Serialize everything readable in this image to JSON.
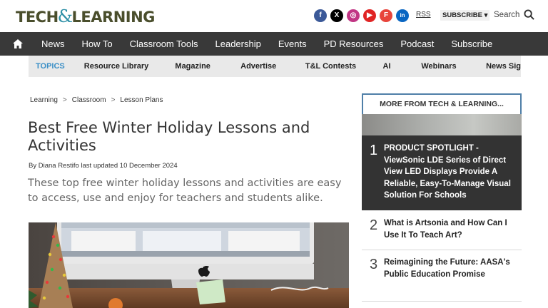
{
  "brand": {
    "logo_left": "TECH",
    "logo_amp": "&",
    "logo_right": "LEARNING"
  },
  "header": {
    "socials": [
      {
        "icon": "facebook-icon",
        "glyph": "f"
      },
      {
        "icon": "x-icon",
        "glyph": "X"
      },
      {
        "icon": "instagram-icon",
        "glyph": "◎"
      },
      {
        "icon": "youtube-icon",
        "glyph": "▶"
      },
      {
        "icon": "flipboard-icon",
        "glyph": "F"
      },
      {
        "icon": "linkedin-icon",
        "glyph": "in"
      }
    ],
    "rss_label": "RSS",
    "subscribe_label": "SUBSCRIBE",
    "subscribe_caret": "▾",
    "search_label": "Search"
  },
  "nav": {
    "items": [
      "News",
      "How To",
      "Classroom Tools",
      "Leadership",
      "Events",
      "PD Resources",
      "Podcast",
      "Subscribe"
    ]
  },
  "topics": {
    "label": "TOPICS",
    "items": [
      "Resource Library",
      "Magazine",
      "Advertise",
      "T&L Contests",
      "AI",
      "Webinars",
      "News Sig"
    ]
  },
  "breadcrumb": {
    "items": [
      "Learning",
      "Classroom",
      "Lesson Plans"
    ],
    "separator": ">"
  },
  "article": {
    "title": "Best Free Winter Holiday Lessons and Activities",
    "byline_prefix": "By",
    "author": "Diana Restifo",
    "updated": "last updated 10 December 2024",
    "standfirst": "These top free winter holiday lessons and activities are easy to access, use and enjoy for teachers and students alike."
  },
  "sidebar": {
    "heading": "MORE FROM TECH & LEARNING...",
    "items": [
      {
        "num": "1",
        "text": "PRODUCT SPOTLIGHT - ViewSonic LDE Series of Direct View LED Displays Provide A Reliable, Easy-To-Manage Visual Solution For Schools"
      },
      {
        "num": "2",
        "text": "What is Artsonia and How Can I Use It To Teach Art?"
      },
      {
        "num": "3",
        "text": "Reimagining the Future: AASA's Public Education Promise"
      }
    ]
  },
  "colors": {
    "nav_bg": "#393939",
    "topics_label": "#3a8fc6",
    "logo_text": "#4a4e2c",
    "logo_amp": "#2d8fa6",
    "sidebar_border": "#4f7fa8",
    "feature_bg": "#333333"
  }
}
